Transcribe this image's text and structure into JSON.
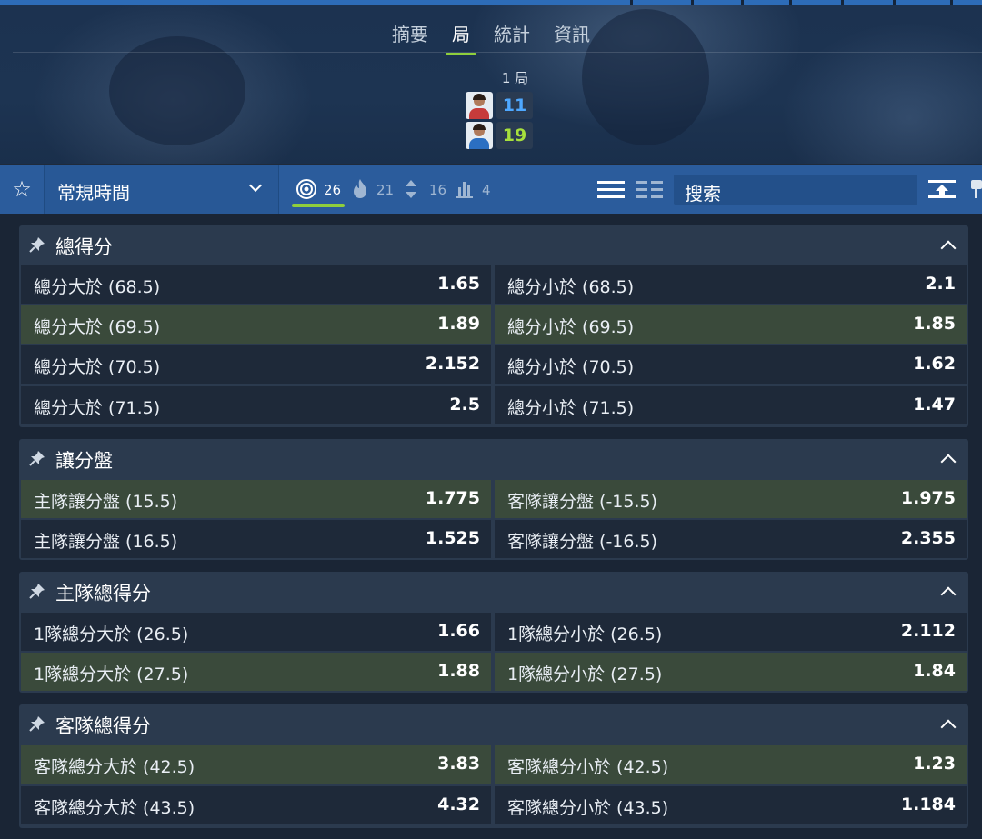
{
  "header": {
    "tabs": [
      {
        "label": "摘要",
        "active": false
      },
      {
        "label": "局",
        "active": true
      },
      {
        "label": "統計",
        "active": false
      },
      {
        "label": "資訊",
        "active": false
      }
    ],
    "set_label": "1 局",
    "home_score": "11",
    "away_score": "19",
    "home_score_color": "#4ea8ff",
    "away_score_color": "#a6e03c"
  },
  "toolbar": {
    "favorite_icon": "star-outline-icon",
    "period_select": "常規時間",
    "filters": [
      {
        "icon": "target-icon",
        "count": "26",
        "active": true
      },
      {
        "icon": "flame-icon",
        "count": "21",
        "active": false
      },
      {
        "icon": "up-down-arrows-icon",
        "count": "16",
        "active": false
      },
      {
        "icon": "bar-stack-icon",
        "count": "4",
        "active": false
      }
    ],
    "search_placeholder": "搜索",
    "accent_color": "#8fcf3c"
  },
  "markets": [
    {
      "title": "總得分",
      "rows": [
        {
          "highlight": false,
          "left": {
            "label": "總分大於 (68.5)",
            "odds": "1.65"
          },
          "right": {
            "label": "總分小於 (68.5)",
            "odds": "2.1"
          }
        },
        {
          "highlight": true,
          "left": {
            "label": "總分大於 (69.5)",
            "odds": "1.89"
          },
          "right": {
            "label": "總分小於 (69.5)",
            "odds": "1.85"
          }
        },
        {
          "highlight": false,
          "left": {
            "label": "總分大於 (70.5)",
            "odds": "2.152"
          },
          "right": {
            "label": "總分小於 (70.5)",
            "odds": "1.62"
          }
        },
        {
          "highlight": false,
          "left": {
            "label": "總分大於 (71.5)",
            "odds": "2.5"
          },
          "right": {
            "label": "總分小於 (71.5)",
            "odds": "1.47"
          }
        }
      ]
    },
    {
      "title": "讓分盤",
      "rows": [
        {
          "highlight": true,
          "left": {
            "label": "主隊讓分盤 (15.5)",
            "odds": "1.775"
          },
          "right": {
            "label": "客隊讓分盤 (-15.5)",
            "odds": "1.975"
          }
        },
        {
          "highlight": false,
          "left": {
            "label": "主隊讓分盤 (16.5)",
            "odds": "1.525"
          },
          "right": {
            "label": "客隊讓分盤 (-16.5)",
            "odds": "2.355"
          }
        }
      ]
    },
    {
      "title": "主隊總得分",
      "rows": [
        {
          "highlight": false,
          "left": {
            "label": "1隊總分大於 (26.5)",
            "odds": "1.66"
          },
          "right": {
            "label": "1隊總分小於 (26.5)",
            "odds": "2.112"
          }
        },
        {
          "highlight": true,
          "left": {
            "label": "1隊總分大於 (27.5)",
            "odds": "1.88"
          },
          "right": {
            "label": "1隊總分小於 (27.5)",
            "odds": "1.84"
          }
        }
      ]
    },
    {
      "title": "客隊總得分",
      "rows": [
        {
          "highlight": true,
          "left": {
            "label": "客隊總分大於 (42.5)",
            "odds": "3.83"
          },
          "right": {
            "label": "客隊總分小於 (42.5)",
            "odds": "1.23"
          }
        },
        {
          "highlight": false,
          "left": {
            "label": "客隊總分大於 (43.5)",
            "odds": "4.32"
          },
          "right": {
            "label": "客隊總分小於 (43.5)",
            "odds": "1.184"
          }
        }
      ]
    }
  ]
}
